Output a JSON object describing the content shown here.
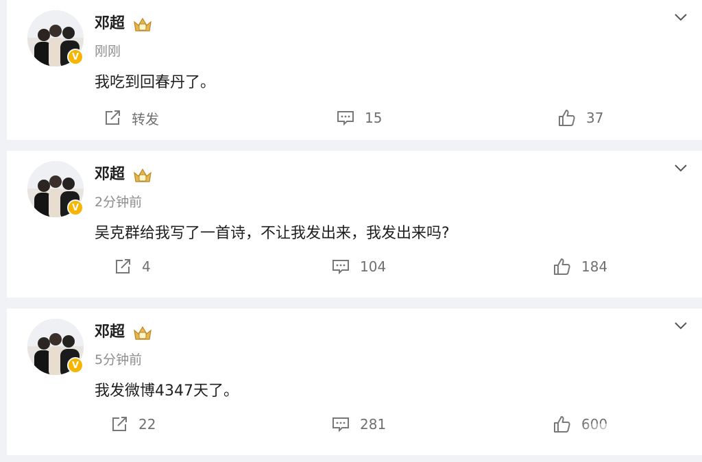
{
  "colors": {
    "background": "#f1f2f5",
    "card": "#ffffff",
    "verified_badge": "#f7b500",
    "text": "#1f1f1f",
    "meta": "#8d8d8d"
  },
  "posts": [
    {
      "user": "邓超",
      "badge": "V",
      "time": "刚刚",
      "text": "我吃到回春丹了。",
      "repost_label": "转发",
      "comments": "15",
      "likes": "37"
    },
    {
      "user": "邓超",
      "badge": "V",
      "time": "2分钟前",
      "text": "吴克群给我写了一首诗，不让我发出来，我发出来吗?",
      "repost_label": "4",
      "comments": "104",
      "likes": "184"
    },
    {
      "user": "邓超",
      "badge": "V",
      "time": "5分钟前",
      "text": "我发微博4347天了。",
      "repost_label": "22",
      "comments": "281",
      "likes": "600"
    }
  ],
  "icons": {
    "repost": "share-icon",
    "comment": "comment-icon",
    "like": "thumbs-up-icon",
    "menu": "chevron-down-icon",
    "member": "crown-icon"
  }
}
